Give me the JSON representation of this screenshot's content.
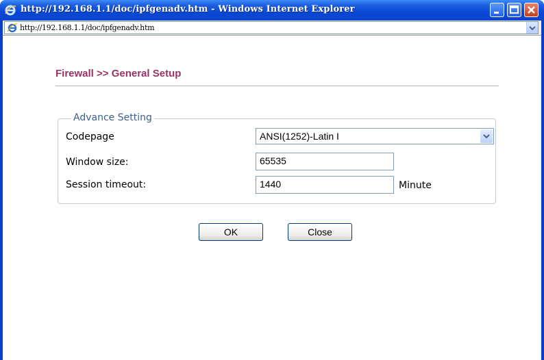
{
  "window": {
    "title": "http://192.168.1.1/doc/ipfgenadv.htm - Windows Internet Explorer",
    "address": "http://192.168.1.1/doc/ipfgenadv.htm"
  },
  "page": {
    "title": "Firewall >> General Setup"
  },
  "advance": {
    "legend": "Advance Setting",
    "codepage_label": "Codepage",
    "codepage_value": "ANSI(1252)-Latin I",
    "window_size_label": "Window size:",
    "window_size_value": "65535",
    "session_timeout_label": "Session timeout:",
    "session_timeout_value": "1440",
    "session_timeout_unit": "Minute"
  },
  "buttons": {
    "ok": "OK",
    "close": "Close"
  },
  "colors": {
    "titlebar": "#0a47d6",
    "page_title": "#993366",
    "legend": "#3b5e8f"
  }
}
